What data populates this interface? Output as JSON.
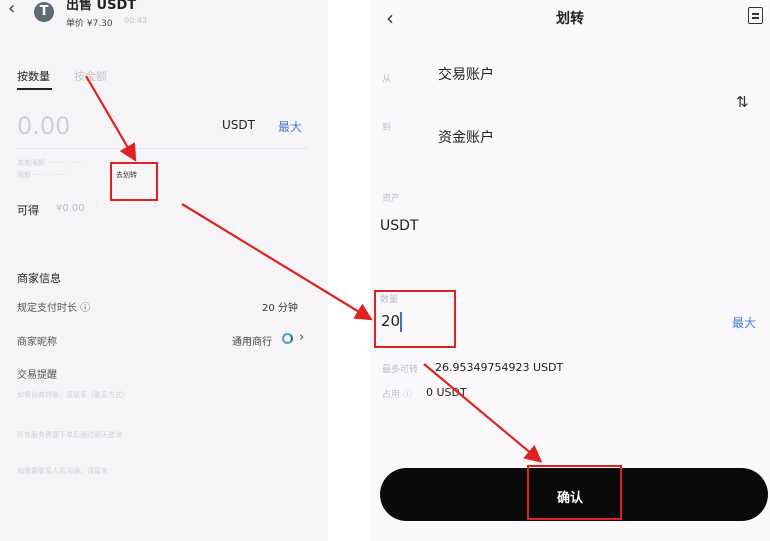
{
  "left": {
    "back_icon": "chevron-left-icon",
    "coin_icon": "tether-icon",
    "coin_glyph": "T",
    "title": "出售 USDT",
    "unit_price": "单价 ¥7.30",
    "unit_time": "00:43",
    "tab_by_quantity": "按数量",
    "tab_by_amount": "按金额",
    "amount_value": "0.00",
    "currency": "USDT",
    "max": "最大",
    "fine_print_1": "单笔限额 ········ · ·····",
    "fine_print_2": "限额 ···· · · ······",
    "transfer_btn": "去划转",
    "available_label": "可得",
    "available_value": "¥0.00",
    "merchant_heading": "商家信息",
    "pay_time_label": "规定支付时长 ⓘ",
    "pay_time_value": "20 分钟",
    "nickname_label": "商家昵称",
    "nickname_value": "通用商行",
    "reminder_label": "交易提醒",
    "reminder_line_1": "如需协商转账，请联系（联系方式）",
    "reminder_line_2": "所有服务需要下单后通过聊天咨询",
    "reminder_line_3": "如需要联系人员沟通，请留言"
  },
  "right": {
    "back_icon": "chevron-left-icon",
    "title": "划转",
    "record_icon": "record-list-icon",
    "from_label": "从",
    "from_value": "交易账户",
    "swap_icon": "swap-vertical-icon",
    "swap_glyph": "⇅",
    "to_label": "到",
    "to_value": "资金账户",
    "asset_label": "资产",
    "asset_value": "USDT",
    "quantity_label": "数量",
    "quantity_value": "20",
    "max": "最大",
    "max_transfer_label": "最多可转",
    "max_transfer_value": "26.95349754923 USDT",
    "occupied_label": "占用 ⓘ",
    "occupied_value": "0 USDT",
    "confirm": "确认"
  },
  "annotation_color": "#e0221f"
}
